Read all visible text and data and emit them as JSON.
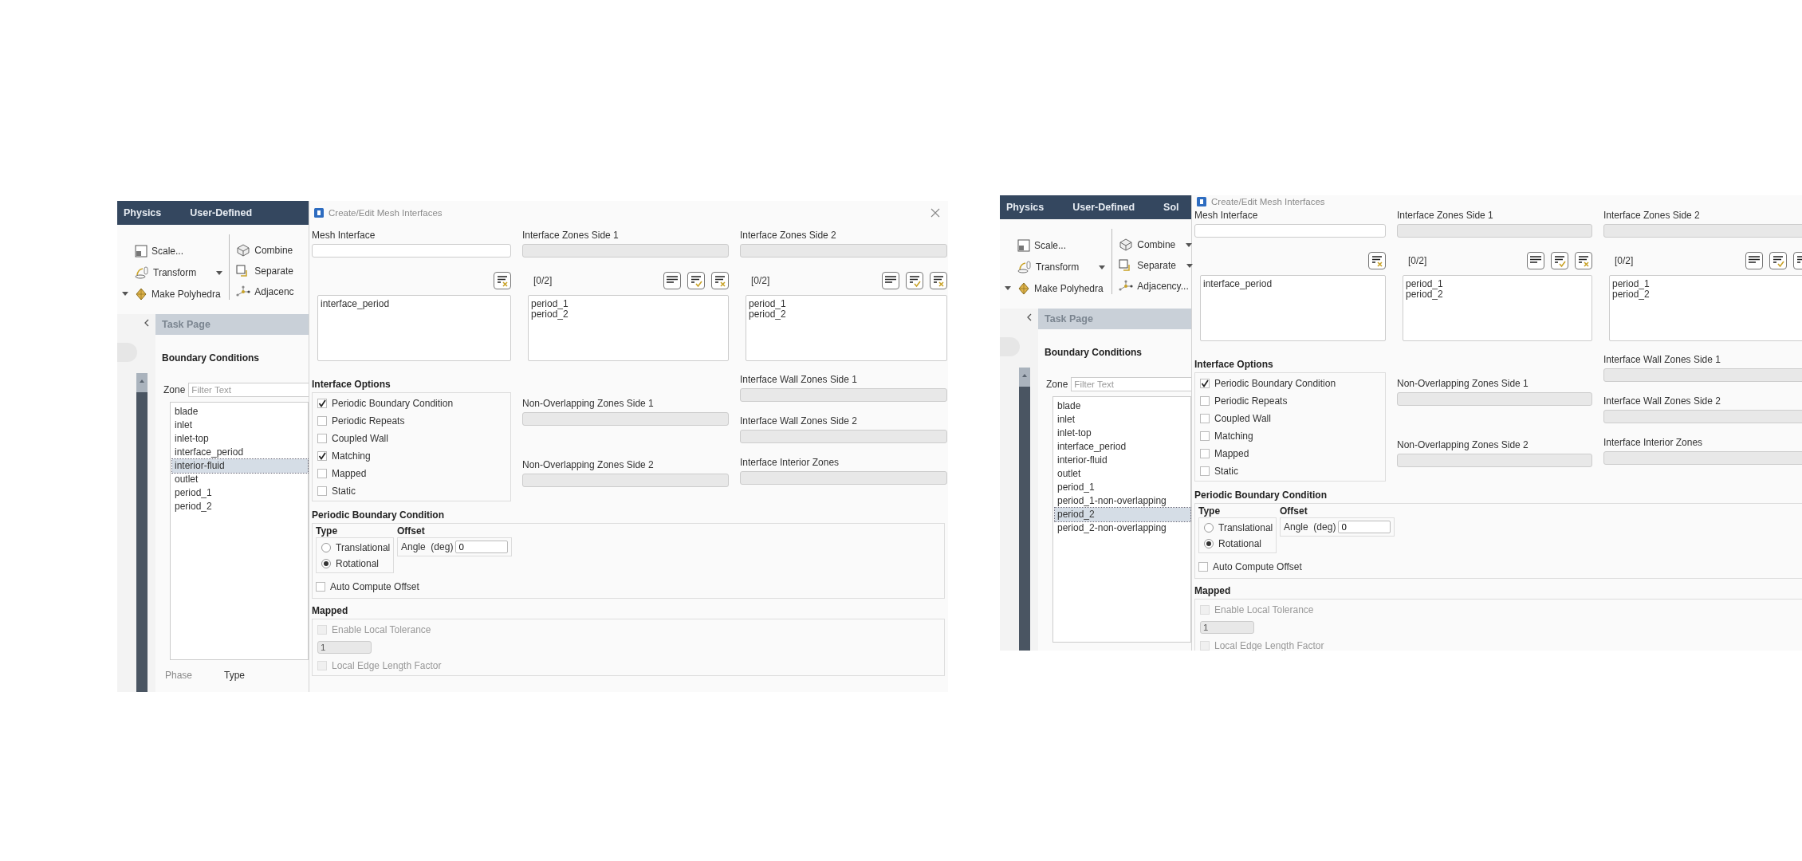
{
  "screenshots": [
    {
      "ribbon_tabs": [
        "Physics",
        "User-Defined"
      ],
      "ribbon_groups": [
        [
          {
            "kind": "scale",
            "label": "Scale...",
            "dropdown": false
          },
          {
            "kind": "transform",
            "label": "Transform",
            "dropdown": true
          },
          {
            "kind": "polyhedra",
            "label": "Make Polyhedra",
            "dropdown": false
          }
        ],
        [
          {
            "kind": "combine",
            "label": "Combine",
            "dropdown": false
          },
          {
            "kind": "separate",
            "label": "Separate",
            "dropdown": false
          },
          {
            "kind": "adjacency",
            "label": "Adjacenc",
            "dropdown": false
          }
        ]
      ],
      "task_page": {
        "header": "Task Page",
        "title": "Boundary Conditions",
        "zone_label": "Zone",
        "filter_placeholder": "Filter Text",
        "zones": [
          {
            "label": "blade",
            "selected": false
          },
          {
            "label": "inlet",
            "selected": false
          },
          {
            "label": "inlet-top",
            "selected": false
          },
          {
            "label": "interface_period",
            "selected": false
          },
          {
            "label": "interior-fluid",
            "selected": true
          },
          {
            "label": "outlet",
            "selected": false
          },
          {
            "label": "period_1",
            "selected": false
          },
          {
            "label": "period_2",
            "selected": false
          }
        ],
        "bottom_labels": [
          "Phase",
          "Type"
        ]
      },
      "dialog": {
        "title": "Create/Edit Mesh Interfaces",
        "mesh_interface_label": "Mesh Interface",
        "interfaces": [
          "interface_period"
        ],
        "zone_sides": [
          {
            "label": "Interface Zones Side 1",
            "count": "[0/2]",
            "items": [
              "period_1",
              "period_2"
            ]
          },
          {
            "label": "Interface Zones Side 2",
            "count": "[0/2]",
            "items": [
              "period_1",
              "period_2"
            ]
          }
        ],
        "options_title": "Interface Options",
        "options": [
          {
            "label": "Periodic Boundary Condition",
            "checked": true
          },
          {
            "label": "Periodic Repeats",
            "checked": false
          },
          {
            "label": "Coupled Wall",
            "checked": false
          },
          {
            "label": "Matching",
            "checked": true
          },
          {
            "label": "Mapped",
            "checked": false
          },
          {
            "label": "Static",
            "checked": false
          }
        ],
        "non_overlapping": [
          "Non-Overlapping Zones Side 1",
          "Non-Overlapping Zones Side 2"
        ],
        "wall_zones": [
          "Interface Wall Zones Side 1",
          "Interface Wall Zones Side 2",
          "Interface Interior Zones"
        ],
        "periodic": {
          "title": "Periodic Boundary Condition",
          "type_label": "Type",
          "types": [
            {
              "label": "Translational",
              "selected": false
            },
            {
              "label": "Rotational",
              "selected": true
            }
          ],
          "offset_label": "Offset",
          "angle_label": "Angle  (deg)",
          "angle_value": "0",
          "auto_compute": {
            "label": "Auto Compute Offset",
            "checked": false
          }
        },
        "mapped": {
          "title": "Mapped",
          "enable_tolerance": {
            "label": "Enable Local Tolerance",
            "checked": false,
            "disabled": true
          },
          "tolerance_value": "1",
          "edge_factor": {
            "label": "Local Edge Length Factor",
            "checked": false,
            "disabled": true
          }
        }
      }
    },
    {
      "ribbon_tabs": [
        "Physics",
        "User-Defined",
        "Sol"
      ],
      "ribbon_groups": [
        [
          {
            "kind": "scale",
            "label": "Scale...",
            "dropdown": false
          },
          {
            "kind": "transform",
            "label": "Transform",
            "dropdown": true
          },
          {
            "kind": "polyhedra",
            "label": "Make Polyhedra",
            "dropdown": false
          }
        ],
        [
          {
            "kind": "combine",
            "label": "Combine",
            "dropdown": true
          },
          {
            "kind": "separate",
            "label": "Separate",
            "dropdown": true
          },
          {
            "kind": "adjacency",
            "label": "Adjacency...",
            "dropdown": false
          }
        ]
      ],
      "task_page": {
        "header": "Task Page",
        "title": "Boundary Conditions",
        "zone_label": "Zone",
        "filter_placeholder": "Filter Text",
        "zones": [
          {
            "label": "blade",
            "selected": false
          },
          {
            "label": "inlet",
            "selected": false
          },
          {
            "label": "inlet-top",
            "selected": false
          },
          {
            "label": "interface_period",
            "selected": false
          },
          {
            "label": "interior-fluid",
            "selected": false
          },
          {
            "label": "outlet",
            "selected": false
          },
          {
            "label": "period_1",
            "selected": false
          },
          {
            "label": "period_1-non-overlapping",
            "selected": false
          },
          {
            "label": "period_2",
            "selected": true
          },
          {
            "label": "period_2-non-overlapping",
            "selected": false
          }
        ]
      },
      "dialog": {
        "title": "Create/Edit Mesh Interfaces",
        "mesh_interface_label": "Mesh Interface",
        "interfaces": [
          "interface_period"
        ],
        "zone_sides": [
          {
            "label": "Interface Zones Side 1",
            "count": "[0/2]",
            "items": [
              "period_1",
              "period_2"
            ]
          },
          {
            "label": "Interface Zones Side 2",
            "count": "[0/2]",
            "items": [
              "period_1",
              "period_2"
            ]
          }
        ],
        "options_title": "Interface Options",
        "options": [
          {
            "label": "Periodic Boundary Condition",
            "checked": true
          },
          {
            "label": "Periodic Repeats",
            "checked": false
          },
          {
            "label": "Coupled Wall",
            "checked": false
          },
          {
            "label": "Matching",
            "checked": false
          },
          {
            "label": "Mapped",
            "checked": false
          },
          {
            "label": "Static",
            "checked": false
          }
        ],
        "non_overlapping": [
          "Non-Overlapping Zones Side 1",
          "Non-Overlapping Zones Side 2"
        ],
        "wall_zones": [
          "Interface Wall Zones Side 1",
          "Interface Wall Zones Side 2",
          "Interface Interior Zones"
        ],
        "periodic": {
          "title": "Periodic Boundary Condition",
          "type_label": "Type",
          "types": [
            {
              "label": "Translational",
              "selected": false
            },
            {
              "label": "Rotational",
              "selected": true
            }
          ],
          "offset_label": "Offset",
          "angle_label": "Angle  (deg)",
          "angle_value": "0",
          "auto_compute": {
            "label": "Auto Compute Offset",
            "checked": false
          }
        },
        "mapped": {
          "title": "Mapped",
          "enable_tolerance": {
            "label": "Enable Local Tolerance",
            "checked": false,
            "disabled": true
          },
          "tolerance_value": "1",
          "edge_factor": {
            "label": "Local Edge Length Factor",
            "checked": false,
            "disabled": true
          }
        }
      }
    }
  ]
}
